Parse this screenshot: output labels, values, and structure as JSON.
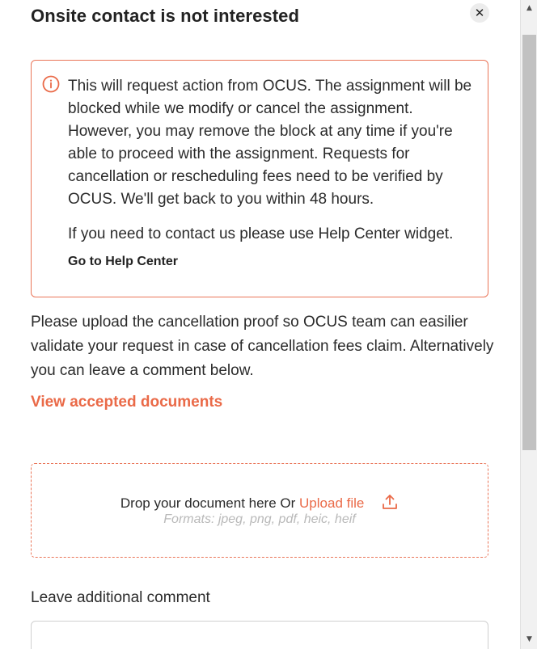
{
  "dialog": {
    "title": "Onsite contact is not interested",
    "close_glyph": "✕"
  },
  "alert": {
    "icon": "info-circle-icon",
    "message": "This will request action from OCUS. The assignment will be blocked while we modify or cancel the assignment. However, you may remove the block at any time if you're able to proceed with the assignment. Requests for cancellation or rescheduling fees need to be verified by OCUS. We'll get back to you within 48 hours.",
    "contact_text": "If you need to contact us please use Help Center widget.",
    "help_link": "Go to Help Center"
  },
  "instructions": "Please upload the cancellation proof so OCUS team can easilier validate your request in case of cancellation fees claim. Alternatively you can leave a comment below.",
  "view_documents_link": "View accepted documents",
  "dropzone": {
    "prompt": "Drop your document here Or",
    "upload_link": "Upload file",
    "formats": "Formats: jpeg, png, pdf, heic, heif"
  },
  "comment": {
    "label": "Leave additional comment"
  },
  "scrollbar": {
    "up_glyph": "▲",
    "down_glyph": "▼"
  },
  "colors": {
    "accent": "#ea6a48",
    "alert_border": "#ea7558"
  }
}
